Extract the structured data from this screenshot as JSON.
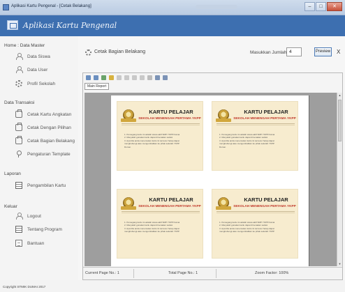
{
  "window": {
    "title": "Aplikasi Kartu Pengenal - [Cetak Belakang]",
    "minimize": "–",
    "maximize": "□",
    "close": "✕"
  },
  "header": {
    "app_name": "Aplikasi Kartu Pengenal"
  },
  "sidebar": {
    "sections": [
      {
        "title": "Home : Data Master",
        "items": [
          {
            "label": "Data Siswa",
            "icon": "person-icon"
          },
          {
            "label": "Data User",
            "icon": "person-icon"
          },
          {
            "label": "Profil Sekolah",
            "icon": "gear-icon"
          }
        ]
      },
      {
        "title": "Data Transaksi",
        "items": [
          {
            "label": "Cetak Kartu Angkatan",
            "icon": "printer-icon"
          },
          {
            "label": "Cetak Dengan Pilihan",
            "icon": "printer-icon"
          },
          {
            "label": "Cetak Bagian Belakang",
            "icon": "printer-icon"
          },
          {
            "label": "Pengaturan Template",
            "icon": "pin-icon"
          }
        ]
      },
      {
        "title": "Laporan",
        "items": [
          {
            "label": "Pengambilan Kartu",
            "icon": "book-icon"
          }
        ]
      },
      {
        "title": "Keluar",
        "items": [
          {
            "label": "Logout",
            "icon": "person-icon"
          },
          {
            "label": "Tentang Program",
            "icon": "book-icon"
          },
          {
            "label": "Bantuan",
            "icon": "document-icon"
          }
        ]
      }
    ]
  },
  "main": {
    "title": "Cetak Bagian Belakang",
    "quantity_label": "Masukkan Jumlah",
    "quantity_value": "4",
    "preview_label": "Preview",
    "close_label": "X"
  },
  "viewer": {
    "tab_label": "Main Report",
    "status": {
      "current_page": "Current Page No.: 1",
      "total_page": "Total Page No.: 1",
      "zoom": "Zoom Factor: 100%"
    }
  },
  "cards": [
    {
      "title": "KARTU PELAJAR",
      "subtitle": "SEKOLAH MENENGAH PERTAMA YKPP",
      "lines": [
        "1. Pemegang kartu ini adalah siswa aktif SMP YKPP Dumai",
        "2. Menyalah gunakan kartu dapat di kenakan sanksi",
        "3. Apa bila anda menemukan kartu ini tercecer harap dapat",
        "    menghubungi atau mengembalikan ke pihak sekolah YKPP",
        "    Dumai."
      ]
    },
    {
      "title": "KARTU PELAJAR",
      "subtitle": "SEKOLAH MENENGAH PERTAMA YKPP",
      "lines": [
        "1. Pemegang kartu ini adalah siswa aktif SMP YKPP Dumai",
        "2. Menyalah gunakan kartu dapat di kenakan sanksi",
        "3. Apa bila anda menemukan kartu ini tercecer harap dapat",
        "    menghubungi atau mengembalikan ke pihak sekolah YKPP",
        "    Dumai."
      ]
    },
    {
      "title": "KARTU PELAJAR",
      "subtitle": "SEKOLAH MENENGAH PERTAMA YKPP",
      "lines": [
        "1. Pemegang kartu ini adalah siswa aktif SMP YKPP Dumai",
        "2. Menyalah gunakan kartu dapat di kenakan sanksi",
        "3. Apa bila anda menemukan kartu ini tercecer harap dapat",
        "    menghubungi atau mengembalikan ke pihak sekolah YKPP"
      ]
    },
    {
      "title": "KARTU PELAJAR",
      "subtitle": "SEKOLAH MENENGAH PERTAMA YKPP",
      "lines": [
        "1. Pemegang kartu ini adalah siswa aktif SMP YKPP Dumai",
        "2. Menyalah gunakan kartu dapat di kenakan sanksi",
        "3. Apa bila anda menemukan kartu ini tercecer harap dapat",
        "    menghubungi atau mengembalikan ke pihak sekolah YKPP"
      ]
    }
  ],
  "footer": {
    "copyright": "Copyright STMIK DUMAI 2017"
  }
}
